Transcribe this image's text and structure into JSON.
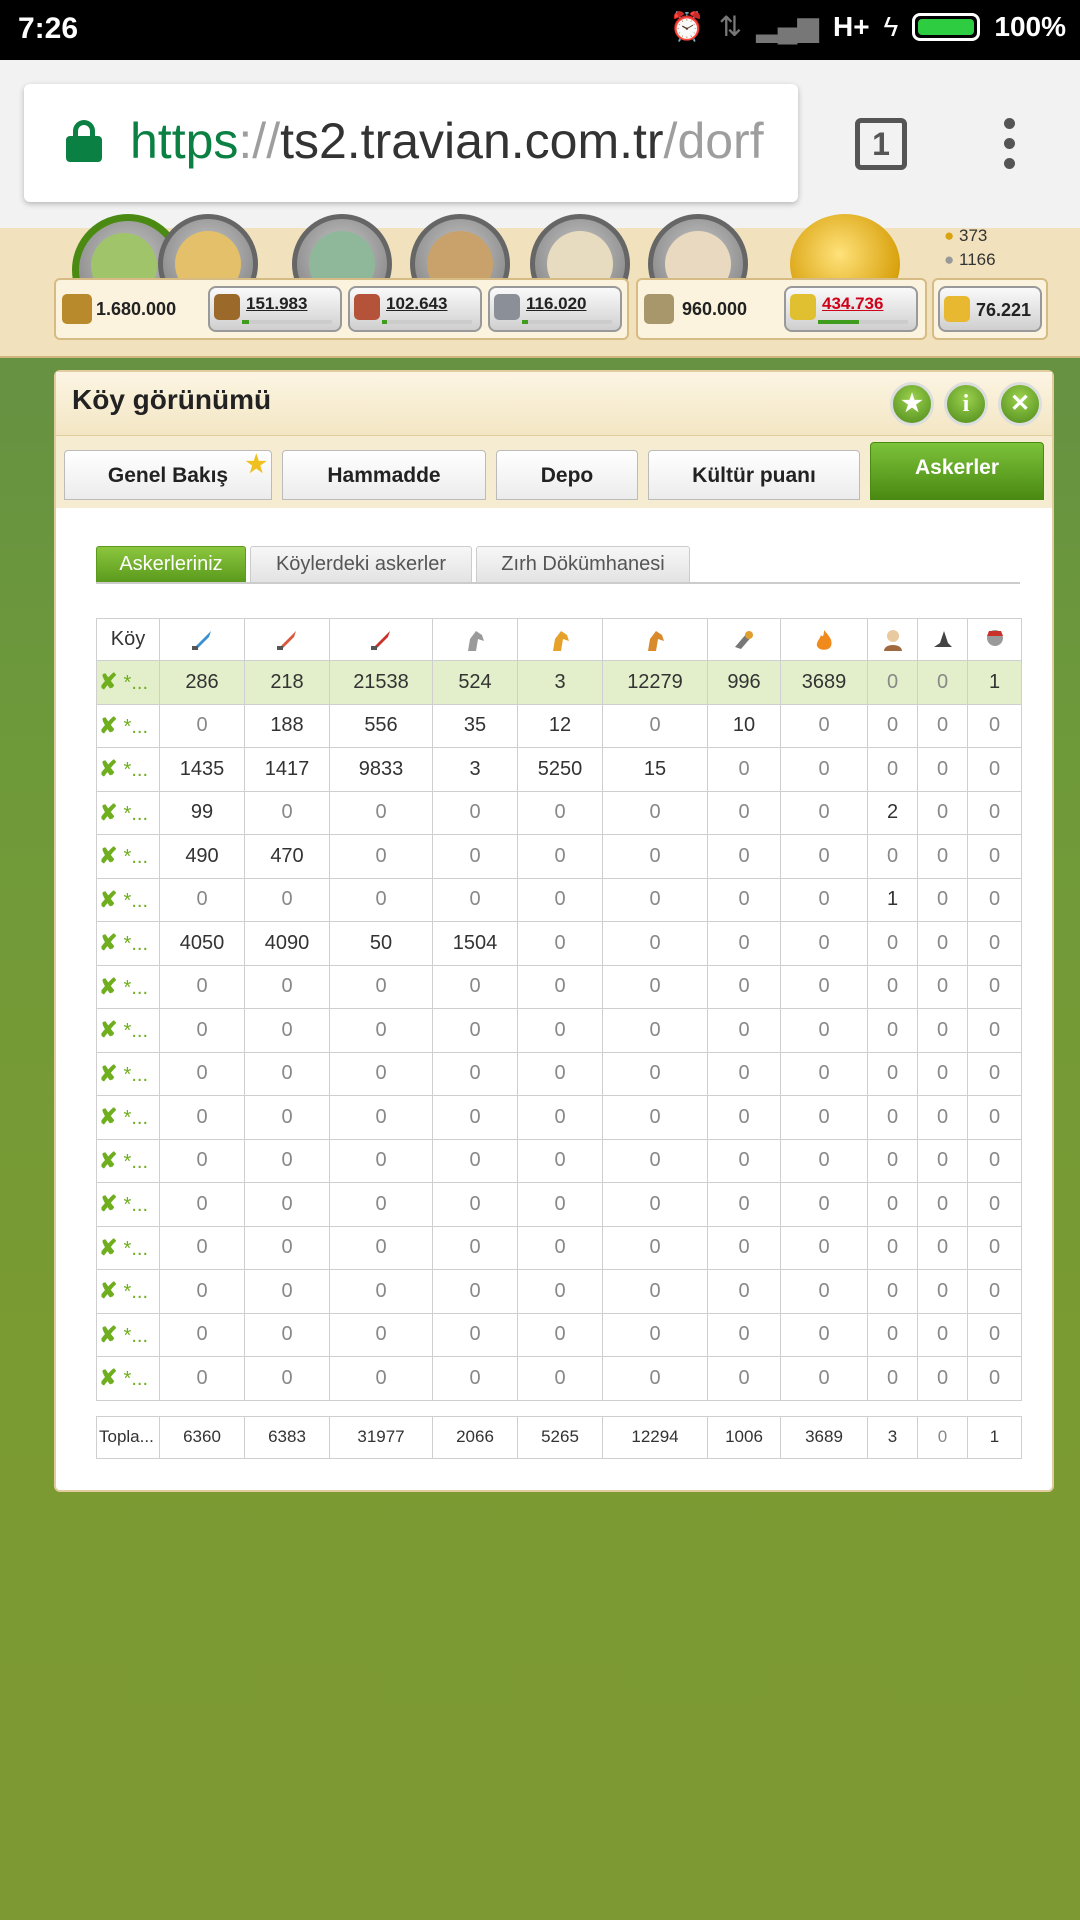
{
  "status_bar": {
    "time": "7:26",
    "network": "H+",
    "battery": "100%"
  },
  "browser": {
    "url_scheme": "https",
    "url_sep": "://",
    "url_host": "ts2.travian.com.tr",
    "url_path": "/dorf",
    "tab_count": "1"
  },
  "game_top": {
    "gold": "373",
    "silver": "1166",
    "warehouse_capacity": "1.680.000",
    "wood": "151.983",
    "clay": "102.643",
    "iron": "116.020",
    "granary_capacity": "960.000",
    "crop": "434.736",
    "crop_production": "76.221",
    "colors": {
      "crop_negative": "#d0021b",
      "accent_green": "#5a9a1c"
    }
  },
  "window": {
    "title": "Köy görünümü",
    "tabs": [
      {
        "label": "Genel Bakış",
        "starred": true
      },
      {
        "label": "Hammadde"
      },
      {
        "label": "Depo"
      },
      {
        "label": "Kültür puanı"
      },
      {
        "label": "Askerler",
        "active": true
      }
    ],
    "subtabs": [
      {
        "label": "Askerleriniz",
        "active": true
      },
      {
        "label": "Köylerdeki askerler"
      },
      {
        "label": "Zırh Dökümhanesi"
      }
    ]
  },
  "table": {
    "village_header": "Köy",
    "unit_icons": [
      "clubswinger-icon",
      "spearman-icon",
      "axeman-icon",
      "scout-icon",
      "paladin-icon",
      "teutonic-knight-icon",
      "ram-icon",
      "catapult-icon",
      "chief-icon",
      "settler-icon",
      "hero-icon"
    ],
    "village_label": "*...",
    "rows": [
      [
        286,
        218,
        21538,
        524,
        3,
        12279,
        996,
        3689,
        0,
        0,
        1
      ],
      [
        0,
        188,
        556,
        35,
        12,
        0,
        10,
        0,
        0,
        0,
        0
      ],
      [
        1435,
        1417,
        9833,
        3,
        5250,
        15,
        0,
        0,
        0,
        0,
        0
      ],
      [
        99,
        0,
        0,
        0,
        0,
        0,
        0,
        0,
        2,
        0,
        0
      ],
      [
        490,
        470,
        0,
        0,
        0,
        0,
        0,
        0,
        0,
        0,
        0
      ],
      [
        0,
        0,
        0,
        0,
        0,
        0,
        0,
        0,
        1,
        0,
        0
      ],
      [
        4050,
        4090,
        50,
        1504,
        0,
        0,
        0,
        0,
        0,
        0,
        0
      ],
      [
        0,
        0,
        0,
        0,
        0,
        0,
        0,
        0,
        0,
        0,
        0
      ],
      [
        0,
        0,
        0,
        0,
        0,
        0,
        0,
        0,
        0,
        0,
        0
      ],
      [
        0,
        0,
        0,
        0,
        0,
        0,
        0,
        0,
        0,
        0,
        0
      ],
      [
        0,
        0,
        0,
        0,
        0,
        0,
        0,
        0,
        0,
        0,
        0
      ],
      [
        0,
        0,
        0,
        0,
        0,
        0,
        0,
        0,
        0,
        0,
        0
      ],
      [
        0,
        0,
        0,
        0,
        0,
        0,
        0,
        0,
        0,
        0,
        0
      ],
      [
        0,
        0,
        0,
        0,
        0,
        0,
        0,
        0,
        0,
        0,
        0
      ],
      [
        0,
        0,
        0,
        0,
        0,
        0,
        0,
        0,
        0,
        0,
        0
      ],
      [
        0,
        0,
        0,
        0,
        0,
        0,
        0,
        0,
        0,
        0,
        0
      ],
      [
        0,
        0,
        0,
        0,
        0,
        0,
        0,
        0,
        0,
        0,
        0
      ]
    ],
    "total_label": "Topla...",
    "totals": [
      6360,
      6383,
      31977,
      2066,
      5265,
      12294,
      1006,
      3689,
      3,
      0,
      1
    ]
  }
}
